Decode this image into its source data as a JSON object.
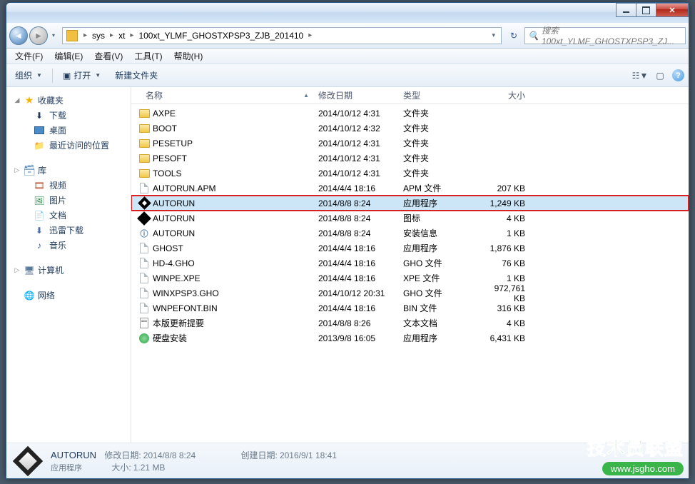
{
  "breadcrumb": {
    "sep": "▸",
    "items": [
      "sys",
      "xt",
      "100xt_YLMF_GHOSTXPSP3_ZJB_201410"
    ]
  },
  "search": {
    "placeholder": "搜索 100xt_YLMF_GHOSTXPSP3_ZJ..."
  },
  "menubar": [
    {
      "label": "文件(F)"
    },
    {
      "label": "编辑(E)"
    },
    {
      "label": "查看(V)"
    },
    {
      "label": "工具(T)"
    },
    {
      "label": "帮助(H)"
    }
  ],
  "toolbar": {
    "organize": "组织",
    "open": "打开",
    "newfolder": "新建文件夹"
  },
  "sidebar": {
    "favorites": {
      "label": "收藏夹",
      "items": [
        {
          "label": "下载",
          "icon": "download"
        },
        {
          "label": "桌面",
          "icon": "desktop"
        },
        {
          "label": "最近访问的位置",
          "icon": "recent"
        }
      ]
    },
    "libraries": {
      "label": "库",
      "items": [
        {
          "label": "视频",
          "icon": "video"
        },
        {
          "label": "图片",
          "icon": "image"
        },
        {
          "label": "文档",
          "icon": "document"
        },
        {
          "label": "迅雷下载",
          "icon": "xunlei"
        },
        {
          "label": "音乐",
          "icon": "music"
        }
      ]
    },
    "computer": {
      "label": "计算机"
    },
    "network": {
      "label": "网络"
    }
  },
  "columns": {
    "name": "名称",
    "date": "修改日期",
    "type": "类型",
    "size": "大小"
  },
  "files": [
    {
      "name": "AXPE",
      "date": "2014/10/12 4:31",
      "type": "文件夹",
      "size": "",
      "icon": "folder"
    },
    {
      "name": "BOOT",
      "date": "2014/10/12 4:32",
      "type": "文件夹",
      "size": "",
      "icon": "folder"
    },
    {
      "name": "PESETUP",
      "date": "2014/10/12 4:31",
      "type": "文件夹",
      "size": "",
      "icon": "folder"
    },
    {
      "name": "PESOFT",
      "date": "2014/10/12 4:31",
      "type": "文件夹",
      "size": "",
      "icon": "folder"
    },
    {
      "name": "TOOLS",
      "date": "2014/10/12 4:31",
      "type": "文件夹",
      "size": "",
      "icon": "folder"
    },
    {
      "name": "AUTORUN.APM",
      "date": "2014/4/4 18:16",
      "type": "APM 文件",
      "size": "207 KB",
      "icon": "file"
    },
    {
      "name": "AUTORUN",
      "date": "2014/8/8 8:24",
      "type": "应用程序",
      "size": "1,249 KB",
      "icon": "exe",
      "selected": true,
      "highlighted": true
    },
    {
      "name": "AUTORUN",
      "date": "2014/8/8 8:24",
      "type": "图标",
      "size": "4 KB",
      "icon": "ico"
    },
    {
      "name": "AUTORUN",
      "date": "2014/8/8 8:24",
      "type": "安装信息",
      "size": "1 KB",
      "icon": "info"
    },
    {
      "name": "GHOST",
      "date": "2014/4/4 18:16",
      "type": "应用程序",
      "size": "1,876 KB",
      "icon": "exe-w"
    },
    {
      "name": "HD-4.GHO",
      "date": "2014/4/4 18:16",
      "type": "GHO 文件",
      "size": "76 KB",
      "icon": "file"
    },
    {
      "name": "WINPE.XPE",
      "date": "2014/4/4 18:16",
      "type": "XPE 文件",
      "size": "1 KB",
      "icon": "file"
    },
    {
      "name": "WINXPSP3.GHO",
      "date": "2014/10/12 20:31",
      "type": "GHO 文件",
      "size": "972,761 KB",
      "icon": "file"
    },
    {
      "name": "WNPEFONT.BIN",
      "date": "2014/4/4 18:16",
      "type": "BIN 文件",
      "size": "316 KB",
      "icon": "file"
    },
    {
      "name": "本版更新提要",
      "date": "2014/8/8 8:26",
      "type": "文本文档",
      "size": "4 KB",
      "icon": "txt"
    },
    {
      "name": "硬盘安装",
      "date": "2013/9/8 16:05",
      "type": "应用程序",
      "size": "6,431 KB",
      "icon": "green"
    }
  ],
  "statusbar": {
    "title": "AUTORUN",
    "subtitle": "应用程序",
    "mod_label": "修改日期:",
    "mod_value": "2014/8/8 8:24",
    "size_label": "大小:",
    "size_value": "1.21 MB",
    "create_label": "创建日期:",
    "create_value": "2016/9/1 18:41"
  },
  "watermark": {
    "text": "技术员联盟",
    "url": "www.jsgho.com"
  }
}
